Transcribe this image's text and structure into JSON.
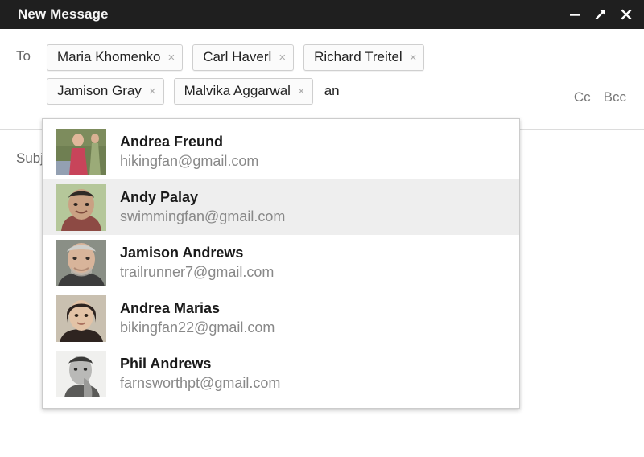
{
  "window": {
    "title": "New Message",
    "controls": [
      {
        "name": "minimize-button",
        "icon": "minimize-icon",
        "label": "Minimize"
      },
      {
        "name": "popout-button",
        "icon": "popout-arrow-icon",
        "label": "Full screen"
      },
      {
        "name": "close-button",
        "icon": "close-icon",
        "label": "Close"
      }
    ],
    "titlebar_bg": "#1f1f1f",
    "titlebar_fg": "#f5f5f5"
  },
  "to_field": {
    "label": "To",
    "typed_text": "an",
    "remove_glyph": "×",
    "chip_rows": [
      [
        {
          "name": "Maria Khomenko"
        },
        {
          "name": "Carl Haverl"
        },
        {
          "name": "Richard Treitel"
        }
      ],
      [
        {
          "name": "Jamison Gray"
        },
        {
          "name": "Malvika Aggarwal"
        }
      ]
    ],
    "cc_label": "Cc",
    "bcc_label": "Bcc"
  },
  "subject_field": {
    "label": "Subject",
    "value": ""
  },
  "body_field": {
    "value": ""
  },
  "autocomplete": {
    "selected_index": 1,
    "highlight_color": "#eeeeee",
    "items": [
      {
        "name": "Andrea Freund",
        "email": "hikingfan@gmail.com",
        "avatar": "woman-red-dress-outdoors-photo",
        "avatar_colors": [
          "#6f7f52",
          "#c8445a",
          "#9bab78"
        ]
      },
      {
        "name": "Andy Palay",
        "email": "swimmingfan@gmail.com",
        "avatar": "man-smiling-green-background-photo",
        "avatar_colors": [
          "#b5c79a",
          "#caa183",
          "#8d4a44"
        ]
      },
      {
        "name": "Jamison Andrews",
        "email": "trailrunner7@gmail.com",
        "avatar": "older-man-gray-hair-photo",
        "avatar_colors": [
          "#8a8f86",
          "#d8b49a",
          "#3c3c3c"
        ]
      },
      {
        "name": "Andrea Marias",
        "email": "bikingfan22@gmail.com",
        "avatar": "woman-dark-hair-photo",
        "avatar_colors": [
          "#c9c0b0",
          "#e3c3a6",
          "#2e2420"
        ]
      },
      {
        "name": "Phil Andrews",
        "email": "farnsworthpt@gmail.com",
        "avatar": "man-black-and-white-portrait-photo",
        "avatar_colors": [
          "#f0f0ee",
          "#b9b9b7",
          "#5a5a58"
        ]
      }
    ]
  }
}
